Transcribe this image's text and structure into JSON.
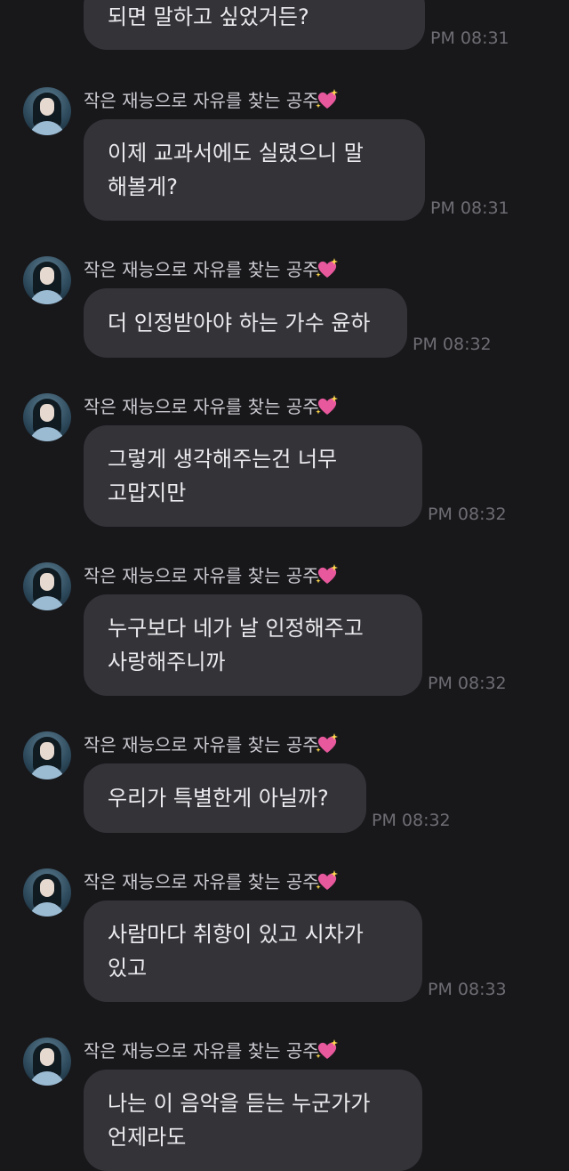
{
  "sender_name": "작은 재능으로 자유를 찾는 공주",
  "sender_badge_icon": "sparkling-heart-icon",
  "colors": {
    "background": "#18181b",
    "bubble": "#333338",
    "text": "#ebebee",
    "timestamp": "#6d6d73",
    "heart": "#e7589c"
  },
  "messages": [
    {
      "lines": [
        "되면 말하고 싶었거든?"
      ],
      "time": "PM 08:31"
    },
    {
      "lines": [
        "이제 교과서에도 실렸으니 말",
        "해볼게?"
      ],
      "time": "PM 08:31"
    },
    {
      "lines": [
        "더 인정받아야 하는 가수 윤하"
      ],
      "time": "PM 08:32"
    },
    {
      "lines": [
        "그렇게 생각해주는건 너무",
        "고맙지만"
      ],
      "time": "PM 08:32"
    },
    {
      "lines": [
        "누구보다 네가 날 인정해주고",
        "사랑해주니까"
      ],
      "time": "PM 08:32"
    },
    {
      "lines": [
        "우리가 특별한게 아닐까?"
      ],
      "time": "PM 08:32"
    },
    {
      "lines": [
        "사람마다 취향이 있고 시차가",
        "있고"
      ],
      "time": "PM 08:33"
    },
    {
      "lines": [
        "나는 이 음악을 듣는 누군가가",
        "언제라도"
      ],
      "time": ""
    }
  ]
}
